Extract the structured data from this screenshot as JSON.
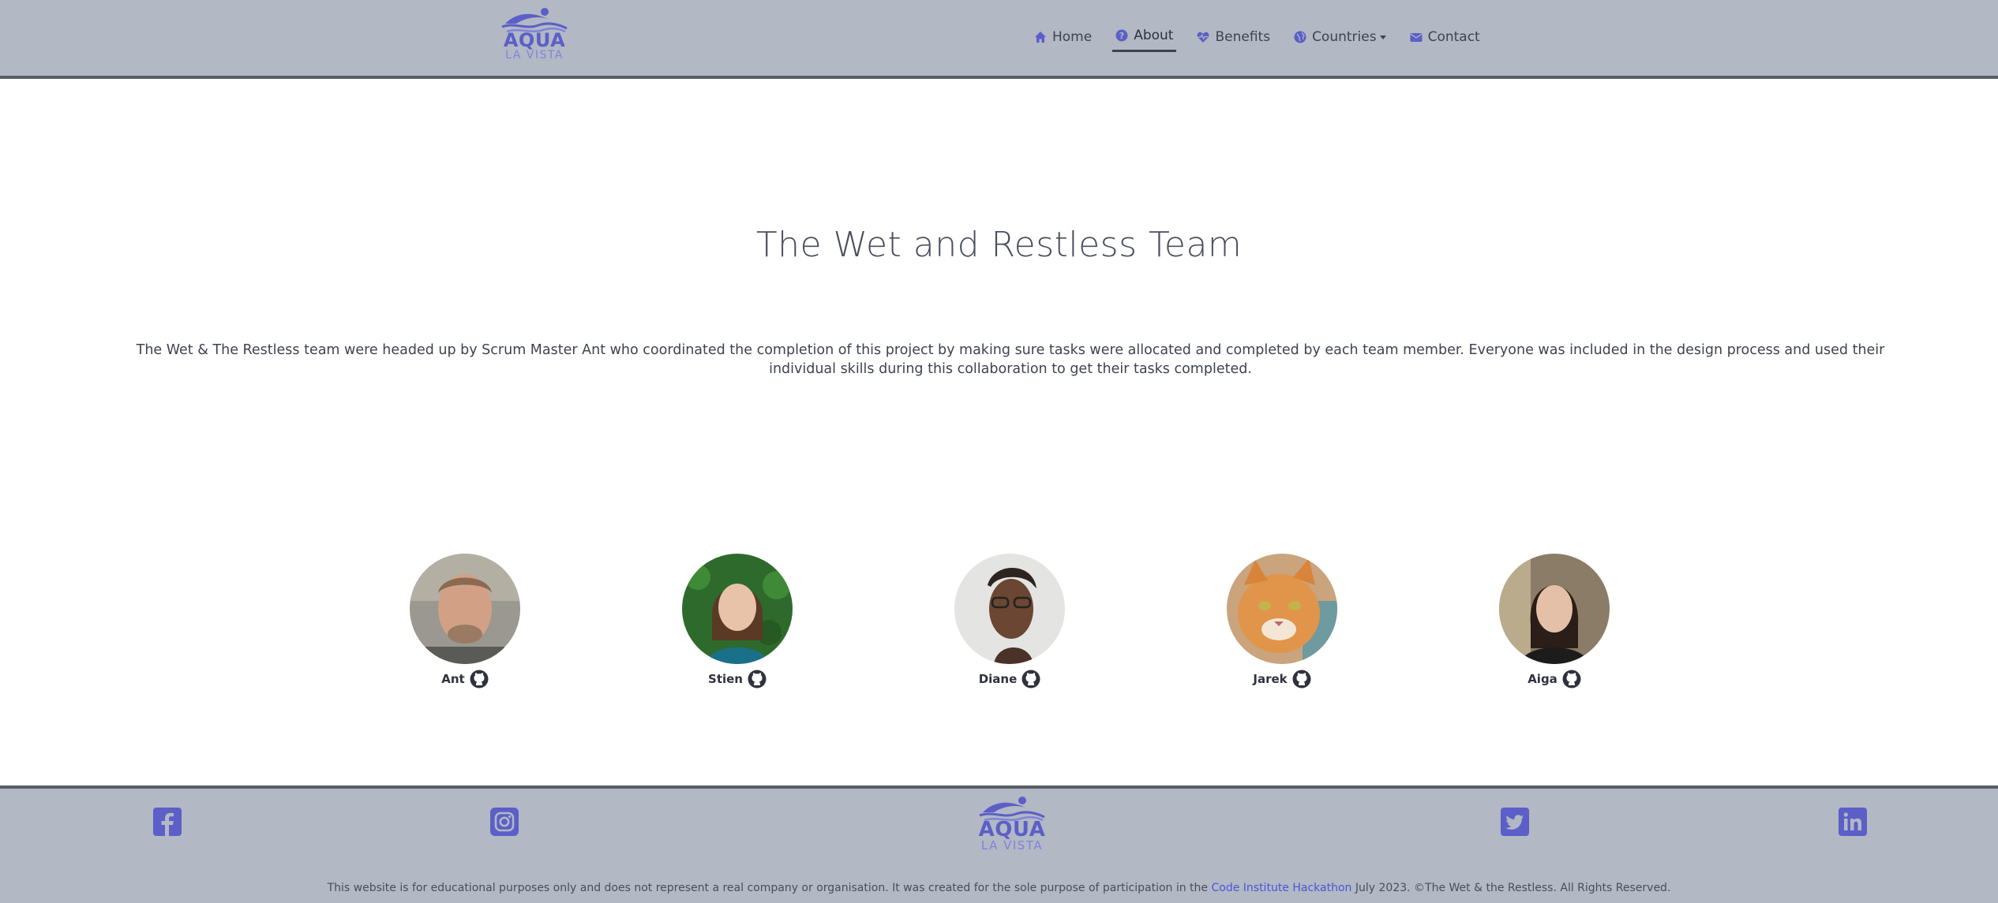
{
  "brand": {
    "name": "AQUA",
    "tagline": "LA VISTA",
    "color": "#5b5fc7"
  },
  "nav": {
    "items": [
      {
        "label": "Home",
        "icon": "home-icon"
      },
      {
        "label": "About",
        "icon": "question-circle-icon",
        "active": true
      },
      {
        "label": "Benefits",
        "icon": "heart-pulse-icon"
      },
      {
        "label": "Countries",
        "icon": "globe-icon",
        "dropdown": true
      },
      {
        "label": "Contact",
        "icon": "envelope-icon"
      }
    ]
  },
  "main": {
    "title": "The Wet and Restless Team",
    "intro": "The Wet & The Restless team were headed up by Scrum Master Ant who coordinated the completion of this project by making sure tasks were allocated and completed by each team member. Everyone was included in the design process and used their individual skills during this collaboration to get their tasks completed."
  },
  "team": [
    {
      "name": "Ant",
      "icon": "github-icon"
    },
    {
      "name": "Stien",
      "icon": "github-icon"
    },
    {
      "name": "Diane",
      "icon": "github-icon"
    },
    {
      "name": "Jarek",
      "icon": "github-icon"
    },
    {
      "name": "Aiga",
      "icon": "github-icon"
    }
  ],
  "footer": {
    "social": [
      "facebook-icon",
      "instagram-icon",
      "twitter-icon",
      "linkedin-icon"
    ],
    "copy_before": "This website is for educational purposes only and does not represent a real company or organisation. It was created for the sole purpose of participation in the ",
    "copy_link": "Code Institute Hackathon",
    "copy_after": " July 2023. ©The Wet & the Restless. All Rights Reserved."
  },
  "colors": {
    "header_bg": "#b2b8c4",
    "accent": "#5b5fc7",
    "border": "#5a5d68"
  }
}
